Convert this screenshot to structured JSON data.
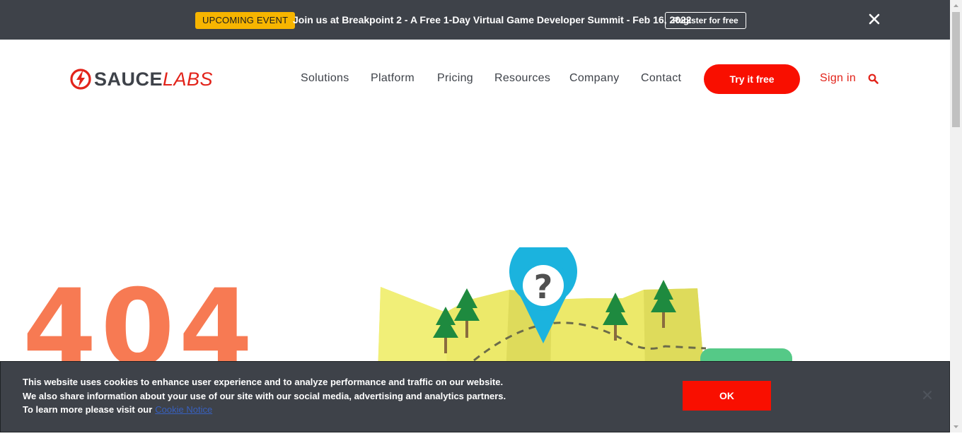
{
  "banner": {
    "badge": "UPCOMING EVENT",
    "message": "Join us at Breakpoint 2 - A Free 1-Day Virtual Game Developer Summit - Feb 16, 2022",
    "register_label": "Register for free",
    "close_icon": "close-icon",
    "badge_color": "#f7b500",
    "background": "#3e4249"
  },
  "header": {
    "logo": {
      "part1": "SAUCE",
      "part2": "LABS"
    },
    "nav": [
      "Solutions",
      "Platform",
      "Pricing",
      "Resources",
      "Company",
      "Contact"
    ],
    "cta_label": "Try it free",
    "signin_label": "Sign in",
    "search_icon": "search-icon",
    "accent_color": "#f90f00"
  },
  "main": {
    "error_code": "404",
    "error_color": "#f77a53",
    "illustration_icon": "map-with-question-pin"
  },
  "cookie": {
    "text": "This website uses cookies to enhance user experience and to analyze performance and traffic on our website. We also share information about your use of our site with our social media, advertising and analytics partners. To learn more please visit our",
    "link_label": "Cookie Notice",
    "ok_label": "OK",
    "close_icon": "close-icon"
  }
}
